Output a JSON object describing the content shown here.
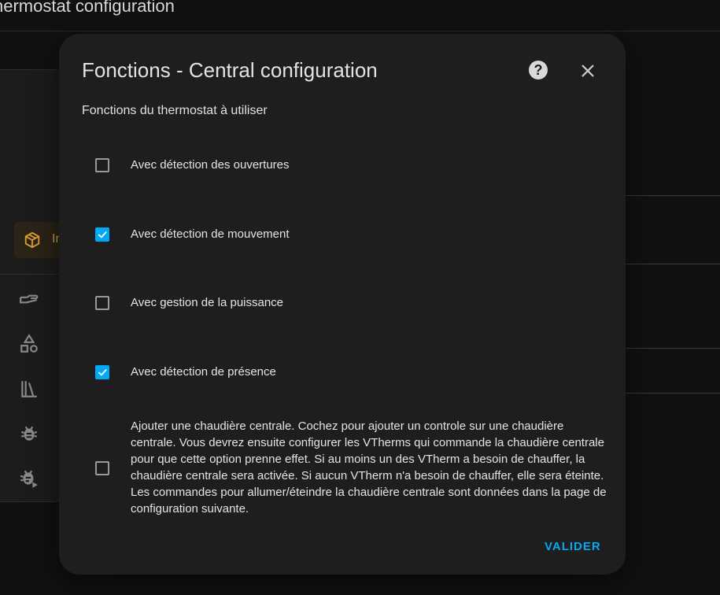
{
  "background": {
    "page_title": "hermostat configuration",
    "integration_chip_label": "In"
  },
  "dialog": {
    "title": "Fonctions - Central configuration",
    "subtitle": "Fonctions du thermostat à utiliser",
    "options": [
      {
        "label": "Avec détection des ouvertures",
        "checked": false
      },
      {
        "label": "Avec détection de mouvement",
        "checked": true
      },
      {
        "label": "Avec gestion de la puissance",
        "checked": false
      },
      {
        "label": "Avec détection de présence",
        "checked": true
      },
      {
        "label": "Ajouter une chaudière centrale. Cochez pour ajouter un controle sur une chaudière centrale. Vous devrez ensuite configurer les VTherms qui commande la chaudière centrale pour que cette option prenne effet. Si au moins un des VTherm a besoin de chauffer, la chaudière centrale sera activée. Si aucun VTherm n'a besoin de chauffer, elle sera éteinte. Les commandes pour allumer/éteindre la chaudière centrale sont données dans la page de configuration suivante.",
        "checked": false
      }
    ],
    "submit_label": "VALIDER",
    "accent_color": "#03a9f4"
  }
}
